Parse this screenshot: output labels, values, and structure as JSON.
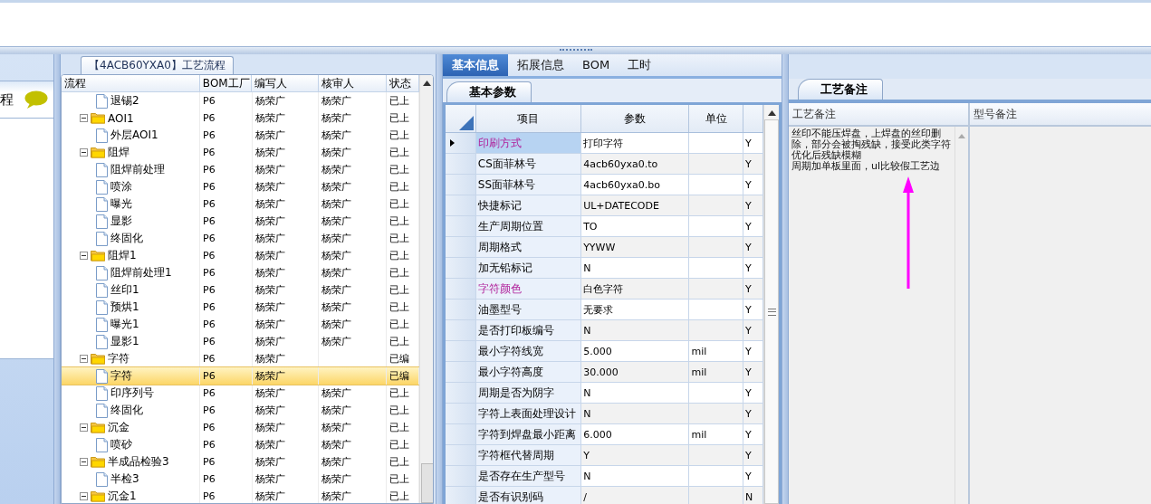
{
  "left_panel": {
    "label": "程"
  },
  "tree": {
    "tab": "【4ACB60YXA0】工艺流程",
    "columns": [
      "流程",
      "BOM工厂",
      "编写人",
      "核审人",
      "状态"
    ],
    "continued": [
      {
        "kind": "step",
        "name": "退锡2",
        "bom": "P6",
        "writer": "杨荣广",
        "reviewer": "杨荣广",
        "status": "已上",
        "selected": false
      }
    ],
    "nodes": [
      {
        "kind": "folder",
        "name": "AOI1",
        "bom": "P6",
        "writer": "杨荣广",
        "reviewer": "杨荣广",
        "status": "已上",
        "selected": false,
        "expanded": true,
        "children": [
          {
            "kind": "step",
            "name": "外层AOI1",
            "bom": "P6",
            "writer": "杨荣广",
            "reviewer": "杨荣广",
            "status": "已上",
            "selected": false
          }
        ]
      },
      {
        "kind": "folder",
        "name": "阻焊",
        "bom": "P6",
        "writer": "杨荣广",
        "reviewer": "杨荣广",
        "status": "已上",
        "selected": false,
        "expanded": true,
        "children": [
          {
            "kind": "step",
            "name": "阻焊前处理",
            "bom": "P6",
            "writer": "杨荣广",
            "reviewer": "杨荣广",
            "status": "已上",
            "selected": false
          },
          {
            "kind": "step",
            "name": "喷涂",
            "bom": "P6",
            "writer": "杨荣广",
            "reviewer": "杨荣广",
            "status": "已上",
            "selected": false
          },
          {
            "kind": "step",
            "name": "曝光",
            "bom": "P6",
            "writer": "杨荣广",
            "reviewer": "杨荣广",
            "status": "已上",
            "selected": false
          },
          {
            "kind": "step",
            "name": "显影",
            "bom": "P6",
            "writer": "杨荣广",
            "reviewer": "杨荣广",
            "status": "已上",
            "selected": false
          },
          {
            "kind": "step",
            "name": "终固化",
            "bom": "P6",
            "writer": "杨荣广",
            "reviewer": "杨荣广",
            "status": "已上",
            "selected": false
          }
        ]
      },
      {
        "kind": "folder",
        "name": "阻焊1",
        "bom": "P6",
        "writer": "杨荣广",
        "reviewer": "杨荣广",
        "status": "已上",
        "selected": false,
        "expanded": true,
        "children": [
          {
            "kind": "step",
            "name": "阻焊前处理1",
            "bom": "P6",
            "writer": "杨荣广",
            "reviewer": "杨荣广",
            "status": "已上",
            "selected": false
          },
          {
            "kind": "step",
            "name": "丝印1",
            "bom": "P6",
            "writer": "杨荣广",
            "reviewer": "杨荣广",
            "status": "已上",
            "selected": false
          },
          {
            "kind": "step",
            "name": "预烘1",
            "bom": "P6",
            "writer": "杨荣广",
            "reviewer": "杨荣广",
            "status": "已上",
            "selected": false
          },
          {
            "kind": "step",
            "name": "曝光1",
            "bom": "P6",
            "writer": "杨荣广",
            "reviewer": "杨荣广",
            "status": "已上",
            "selected": false
          },
          {
            "kind": "step",
            "name": "显影1",
            "bom": "P6",
            "writer": "杨荣广",
            "reviewer": "杨荣广",
            "status": "已上",
            "selected": false
          }
        ]
      },
      {
        "kind": "folder",
        "name": "字符",
        "bom": "P6",
        "writer": "杨荣广",
        "status": "已编",
        "selected": false,
        "expanded": true,
        "children": [
          {
            "kind": "step",
            "name": "字符",
            "bom": "P6",
            "writer": "杨荣广",
            "status": "已编",
            "selected": true
          },
          {
            "kind": "step",
            "name": "印序列号",
            "bom": "P6",
            "writer": "杨荣广",
            "reviewer": "杨荣广",
            "status": "已上",
            "selected": false
          },
          {
            "kind": "step",
            "name": "终固化",
            "bom": "P6",
            "writer": "杨荣广",
            "reviewer": "杨荣广",
            "status": "已上",
            "selected": false
          }
        ]
      },
      {
        "kind": "folder",
        "name": "沉金",
        "bom": "P6",
        "writer": "杨荣广",
        "reviewer": "杨荣广",
        "status": "已上",
        "selected": false,
        "expanded": true,
        "children": [
          {
            "kind": "step",
            "name": "喷砂",
            "bom": "P6",
            "writer": "杨荣广",
            "reviewer": "杨荣广",
            "status": "已上",
            "selected": false
          }
        ]
      },
      {
        "kind": "folder",
        "name": "半成品检验3",
        "bom": "P6",
        "writer": "杨荣广",
        "reviewer": "杨荣广",
        "status": "已上",
        "selected": false,
        "expanded": true,
        "children": [
          {
            "kind": "step",
            "name": "半检3",
            "bom": "P6",
            "writer": "杨荣广",
            "reviewer": "杨荣广",
            "status": "已上",
            "selected": false
          }
        ]
      },
      {
        "kind": "folder",
        "name": "沉金1",
        "bom": "P6",
        "writer": "杨荣广",
        "reviewer": "杨荣广",
        "status": "已上",
        "selected": false,
        "expanded": true
      }
    ]
  },
  "main_tabs": [
    {
      "label": "基本信息",
      "selected": true
    },
    {
      "label": "拓展信息",
      "selected": false
    },
    {
      "label": "BOM",
      "selected": false
    },
    {
      "label": "工时",
      "selected": false
    }
  ],
  "params": {
    "tab": "基本参数",
    "columns": [
      "项目",
      "参数",
      "单位"
    ],
    "rows": [
      {
        "item": "印刷方式",
        "value": "打印字符",
        "flag": "Y",
        "highlighted": true,
        "selected": true
      },
      {
        "item": "CS面菲林号",
        "value": "4acb60yxa0.to",
        "flag": "Y",
        "highlighted": false,
        "selected": false
      },
      {
        "item": "SS面菲林号",
        "value": "4acb60yxa0.bo",
        "flag": "Y",
        "highlighted": false,
        "selected": false
      },
      {
        "item": "快捷标记",
        "value": "UL+DATECODE",
        "flag": "Y",
        "highlighted": false,
        "selected": false
      },
      {
        "item": "生产周期位置",
        "value": "TO",
        "flag": "Y",
        "highlighted": false,
        "selected": false
      },
      {
        "item": "周期格式",
        "value": "YYWW",
        "flag": "Y",
        "highlighted": false,
        "selected": false
      },
      {
        "item": "加无铅标记",
        "value": "N",
        "flag": "Y",
        "highlighted": false,
        "selected": false
      },
      {
        "item": "字符颜色",
        "value": "白色字符",
        "flag": "Y",
        "highlighted": true,
        "selected": false
      },
      {
        "item": "油墨型号",
        "value": "无要求",
        "flag": "Y",
        "highlighted": false,
        "selected": false
      },
      {
        "item": "是否打印板编号",
        "value": "N",
        "flag": "Y",
        "highlighted": false,
        "selected": false
      },
      {
        "item": "最小字符线宽",
        "value": "5.000",
        "unit": "mil",
        "flag": "Y",
        "highlighted": false,
        "selected": false
      },
      {
        "item": "最小字符高度",
        "value": "30.000",
        "unit": "mil",
        "flag": "Y",
        "highlighted": false,
        "selected": false
      },
      {
        "item": "周期是否为阴字",
        "value": "N",
        "flag": "Y",
        "highlighted": false,
        "selected": false
      },
      {
        "item": "字符上表面处理设计",
        "value": "N",
        "flag": "Y",
        "highlighted": false,
        "selected": false
      },
      {
        "item": "字符到焊盘最小距离",
        "value": "6.000",
        "unit": "mil",
        "flag": "Y",
        "highlighted": false,
        "selected": false
      },
      {
        "item": "字符框代替周期",
        "value": "Y",
        "flag": "Y",
        "highlighted": false,
        "selected": false
      },
      {
        "item": "是否存在生产型号",
        "value": "N",
        "flag": "Y",
        "highlighted": false,
        "selected": false
      },
      {
        "item": "是否有识别码",
        "value": "/",
        "flag": "N",
        "highlighted": false,
        "selected": false
      }
    ]
  },
  "notes": {
    "tab": "工艺备注",
    "columns": [
      "工艺备注",
      "型号备注"
    ],
    "process_note": [
      "丝印不能压焊盘，上焊盘的丝印删除，部分会被掏残缺，接受此类字符优化后残缺模糊",
      "周期加单板里面，ul比较假工艺边"
    ]
  }
}
